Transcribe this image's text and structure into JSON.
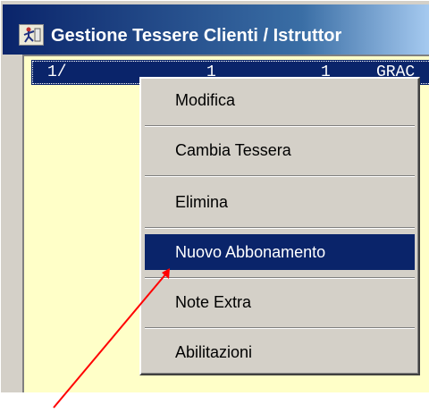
{
  "window": {
    "title": "Gestione Tessere Clienti / Istruttor",
    "title_icon": "app-figure-icon"
  },
  "list": {
    "selected_row": {
      "col1": "1/",
      "col2": "1",
      "col3": "1",
      "col4": "GRAC"
    }
  },
  "context_menu": {
    "items": [
      {
        "label": "Modifica",
        "selected": false
      },
      {
        "label": "Cambia Tessera",
        "selected": false
      },
      {
        "label": "Elimina",
        "selected": false
      },
      {
        "label": "Nuovo Abbonamento",
        "selected": true
      },
      {
        "label": "Note Extra",
        "selected": false
      },
      {
        "label": "Abilitazioni",
        "selected": false
      }
    ]
  },
  "annotation": {
    "arrow_color": "#ff0000",
    "arrow_target": "Nuovo Abbonamento"
  },
  "colors": {
    "selection": "#0a246a",
    "list_background": "#ffffc8",
    "menu_background": "#d4d0c8"
  }
}
